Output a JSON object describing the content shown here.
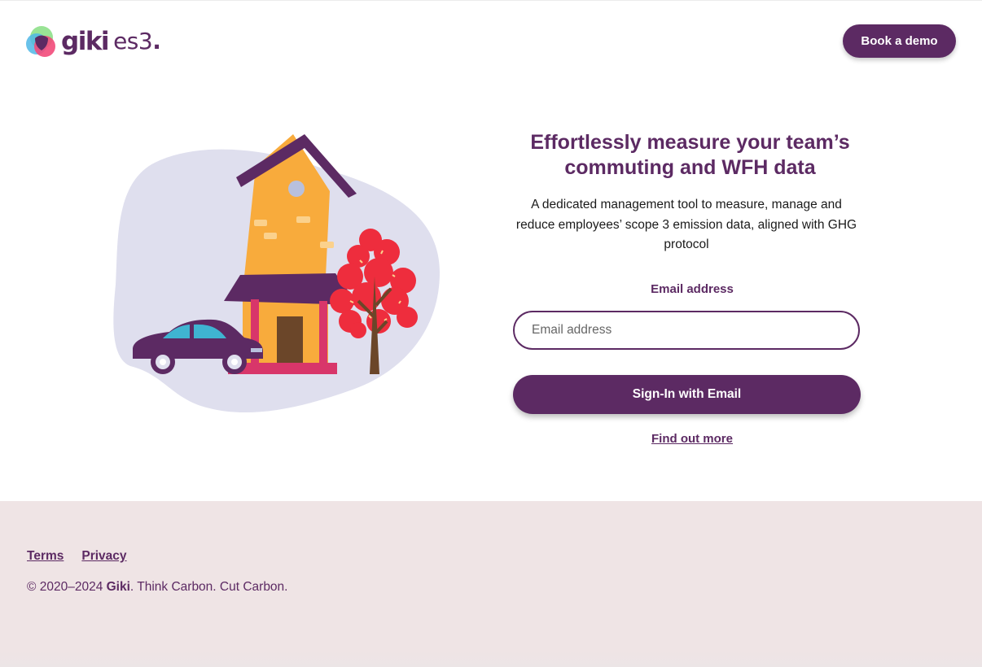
{
  "header": {
    "logo_wordmark": "giki",
    "logo_product": "es3",
    "logo_dot": ".",
    "book_demo_label": "Book a demo"
  },
  "hero": {
    "title": "Effortlessly measure your team’s commuting and WFH data",
    "subtitle": "A dedicated management tool to measure, manage and reduce employees’ scope 3 emission data, aligned with GHG protocol"
  },
  "form": {
    "email_label": "Email address",
    "email_placeholder": "Email address",
    "email_value": "",
    "signin_label": "Sign-In with Email",
    "find_out_more": "Find out more"
  },
  "footer": {
    "links": [
      {
        "label": "Terms"
      },
      {
        "label": "Privacy"
      }
    ],
    "copyright_prefix": "© 2020–2024 ",
    "copyright_brand": "Giki",
    "copyright_suffix": ". Think Carbon. Cut Carbon."
  },
  "colors": {
    "brand": "#5c2a63",
    "footer_bg": "#efe4e5",
    "house": "#f8ab3c",
    "tree": "#ee2d3d",
    "blob": "#dfdfee"
  }
}
